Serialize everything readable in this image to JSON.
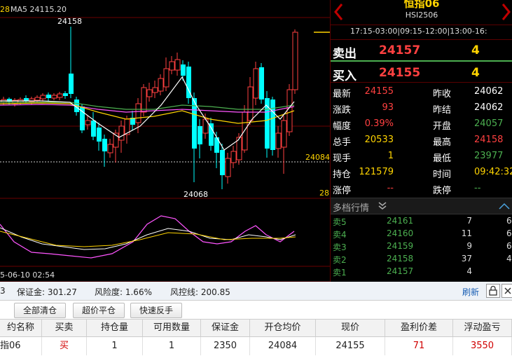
{
  "chart": {
    "indicator_value": "28",
    "ma5_label": "MA5 24115.20",
    "high_label": "24158",
    "low_label": "24068",
    "price_line_label": "24084",
    "right_bottom_label": "28",
    "time_label": "5-06-10 02:54"
  },
  "quote": {
    "title": "恒指06",
    "code": "HSI2506",
    "sessions": "17:15-03:00|09:15-12:00|13:00-16:",
    "sell": {
      "label": "卖出",
      "price": "24157",
      "qty": "4"
    },
    "buy": {
      "label": "买入",
      "price": "24155",
      "qty": "4"
    },
    "stats_left": [
      {
        "label": "最新",
        "value": "24155"
      },
      {
        "label": "涨跌",
        "value": "93"
      },
      {
        "label": "幅度",
        "value": "0.39%"
      },
      {
        "label": "总手",
        "value": "20533"
      },
      {
        "label": "现手",
        "value": "1"
      },
      {
        "label": "持仓",
        "value": "121579"
      },
      {
        "label": "涨停",
        "value": "--"
      }
    ],
    "stats_right": [
      {
        "label": "昨收",
        "value": "24062"
      },
      {
        "label": "昨结",
        "value": "24062"
      },
      {
        "label": "开盘",
        "value": "24057"
      },
      {
        "label": "最高",
        "value": "24158"
      },
      {
        "label": "最低",
        "value": "23977"
      },
      {
        "label": "时间",
        "value": "09:42:32"
      },
      {
        "label": "跌停",
        "value": "--"
      }
    ],
    "orderbook_title": "多档行情",
    "orderbook": [
      {
        "label": "卖5",
        "price": "24161",
        "qty": "7",
        "extra": "6"
      },
      {
        "label": "卖4",
        "price": "24160",
        "qty": "11",
        "extra": "6"
      },
      {
        "label": "卖3",
        "price": "24159",
        "qty": "9",
        "extra": "6"
      },
      {
        "label": "卖2",
        "price": "24158",
        "qty": "37",
        "extra": "4"
      },
      {
        "label": "卖1",
        "price": "24157",
        "qty": "4",
        "extra": ""
      }
    ]
  },
  "account": {
    "prefix": "3",
    "margin": "保证金: 301.27",
    "risk": "风险度: 1.66%",
    "risk_line": "风控线: 200.85",
    "refresh": "刷新"
  },
  "buttons": {
    "close_all": "全部清仓",
    "super_close": "超价平仓",
    "quick_reverse": "快速反手"
  },
  "positions": {
    "headers": [
      "约名称",
      "买卖",
      "持仓量",
      "可用数量",
      "保证金",
      "开仓均价",
      "现价",
      "盈利价差",
      "浮动盈亏"
    ],
    "row": [
      "指06",
      "买",
      "1",
      "1",
      "2350",
      "24084",
      "24155",
      "71",
      "3550"
    ]
  }
}
